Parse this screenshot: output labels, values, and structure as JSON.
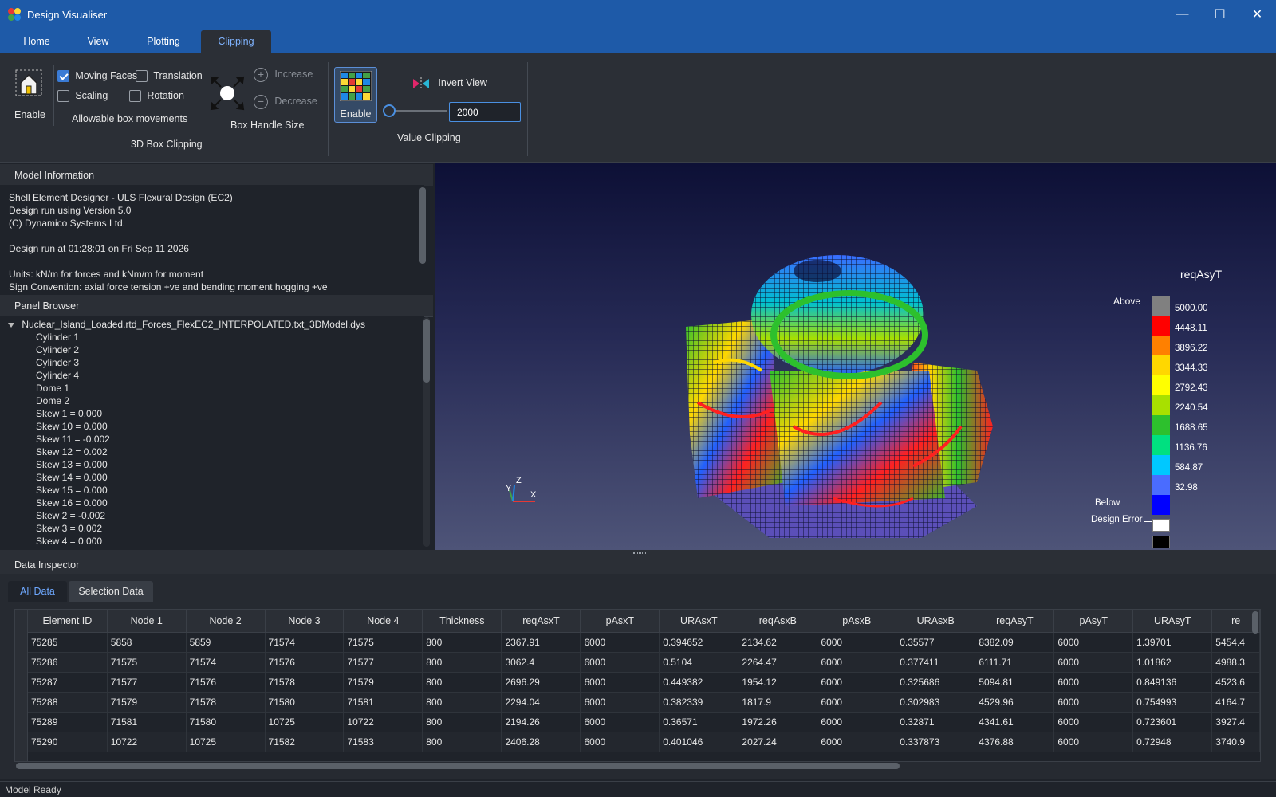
{
  "app": {
    "title": "Design Visualiser"
  },
  "window_controls": {
    "minimize": "—",
    "maximize": "☐",
    "close": "✕"
  },
  "ribbon_tabs": [
    "Home",
    "View",
    "Plotting",
    "Clipping"
  ],
  "active_tab": "Clipping",
  "box_clipping": {
    "enable_label": "Enable",
    "moving_faces": {
      "label": "Moving Faces",
      "checked": true
    },
    "translation": {
      "label": "Translation",
      "checked": false
    },
    "scaling": {
      "label": "Scaling",
      "checked": false
    },
    "rotation": {
      "label": "Rotation",
      "checked": false
    },
    "allowable_label": "Allowable box movements",
    "increase_label": "Increase",
    "decrease_label": "Decrease",
    "handle_size_label": "Box Handle Size",
    "group_label": "3D Box Clipping"
  },
  "value_clipping": {
    "enable_label": "Enable",
    "invert_label": "Invert View",
    "value": "2000",
    "slider_level": 0.0,
    "group_label": "Value Clipping"
  },
  "model_info": {
    "header": "Model Information",
    "lines": [
      "Shell Element Designer - ULS Flexural Design (EC2)",
      "Design run using Version 5.0",
      "(C) Dynamico Systems Ltd.",
      "",
      "Design run at 01:28:01 on Fri Sep 11 2026",
      "",
      "Units: kN/m for forces and kNm/m for moment",
      "Sign Convention: axial force tension +ve and bending moment hogging +ve"
    ]
  },
  "panel_browser": {
    "header": "Panel Browser",
    "root": "Nuclear_Island_Loaded.rtd_Forces_FlexEC2_INTERPOLATED.txt_3DModel.dys",
    "items": [
      "Cylinder 1",
      "Cylinder 2",
      "Cylinder 3",
      "Cylinder 4",
      "Dome 1",
      "Dome 2",
      "Skew 1 = 0.000",
      "Skew 10 = 0.000",
      "Skew 11 = -0.002",
      "Skew 12 = 0.002",
      "Skew 13 = 0.000",
      "Skew 14 = 0.000",
      "Skew 15 = 0.000",
      "Skew 16 = 0.000",
      "Skew 2 = -0.002",
      "Skew 3 = 0.002",
      "Skew 4 = 0.000"
    ]
  },
  "legend": {
    "title": "reqAsyT",
    "above_label": "Above",
    "below_label": "Below",
    "error_label": "Design Error",
    "values": [
      "5000.00",
      "4448.11",
      "3896.22",
      "3344.33",
      "2792.43",
      "2240.54",
      "1688.65",
      "1136.76",
      "584.87",
      "32.98"
    ],
    "colors": [
      "#ff0000",
      "#ff8000",
      "#ffd700",
      "#ffff00",
      "#a8e000",
      "#2dc02d",
      "#00e080",
      "#00c8ff",
      "#4a6cff",
      "#0000ff"
    ],
    "above_color": "#808080",
    "below_color": "#ffffff",
    "error_color": "#000000"
  },
  "axes_triad": {
    "x": "X",
    "y": "Y",
    "z": "Z"
  },
  "data_inspector": {
    "header": "Data Inspector",
    "tabs": [
      "All Data",
      "Selection Data"
    ],
    "columns": [
      "Element ID",
      "Node 1",
      "Node 2",
      "Node 3",
      "Node 4",
      "Thickness",
      "reqAsxT",
      "pAsxT",
      "URAsxT",
      "reqAsxB",
      "pAsxB",
      "URAsxB",
      "reqAsyT",
      "pAsyT",
      "URAsyT",
      "re"
    ],
    "rows": [
      [
        "75285",
        "5858",
        "5859",
        "71574",
        "71575",
        "800",
        "2367.91",
        "6000",
        "0.394652",
        "2134.62",
        "6000",
        "0.35577",
        "8382.09",
        "6000",
        "1.39701",
        "5454.4"
      ],
      [
        "75286",
        "71575",
        "71574",
        "71576",
        "71577",
        "800",
        "3062.4",
        "6000",
        "0.5104",
        "2264.47",
        "6000",
        "0.377411",
        "6111.71",
        "6000",
        "1.01862",
        "4988.3"
      ],
      [
        "75287",
        "71577",
        "71576",
        "71578",
        "71579",
        "800",
        "2696.29",
        "6000",
        "0.449382",
        "1954.12",
        "6000",
        "0.325686",
        "5094.81",
        "6000",
        "0.849136",
        "4523.6"
      ],
      [
        "75288",
        "71579",
        "71578",
        "71580",
        "71581",
        "800",
        "2294.04",
        "6000",
        "0.382339",
        "1817.9",
        "6000",
        "0.302983",
        "4529.96",
        "6000",
        "0.754993",
        "4164.7"
      ],
      [
        "75289",
        "71581",
        "71580",
        "10725",
        "10722",
        "800",
        "2194.26",
        "6000",
        "0.36571",
        "1972.26",
        "6000",
        "0.32871",
        "4341.61",
        "6000",
        "0.723601",
        "3927.4"
      ],
      [
        "75290",
        "10722",
        "10725",
        "71582",
        "71583",
        "800",
        "2406.28",
        "6000",
        "0.401046",
        "2027.24",
        "6000",
        "0.337873",
        "4376.88",
        "6000",
        "0.72948",
        "3740.9"
      ]
    ]
  },
  "status": "Model Ready"
}
